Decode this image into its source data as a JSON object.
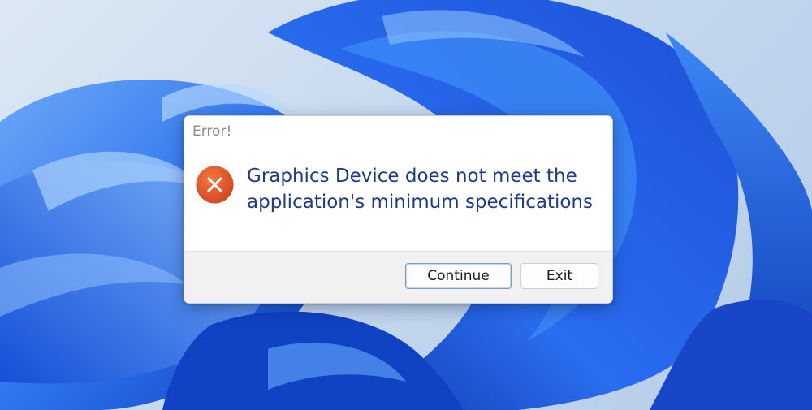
{
  "dialog": {
    "title": "Error!",
    "icon": "error-icon",
    "message": "Graphics Device does not meet the application's minimum specifications",
    "buttons": {
      "continue_label": "Continue",
      "exit_label": "Exit"
    }
  },
  "colors": {
    "message_text": "#1f3a8a",
    "error_icon": "#e0532a",
    "wallpaper_blue": "#1e5fe0"
  }
}
